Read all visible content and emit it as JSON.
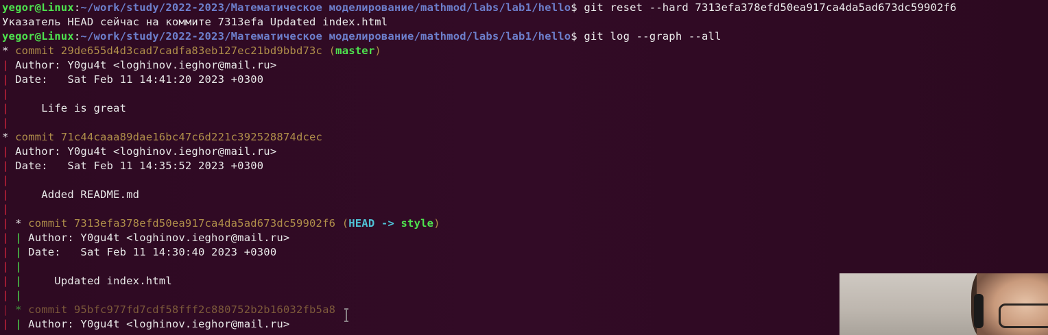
{
  "prompt1": {
    "user_host": "yegor@Linux",
    "sep": ":",
    "path": "~/work/study/2022-2023/Математическое моделирование/mathmod/labs/lab1/hello",
    "dollar": "$ ",
    "command": "git reset --hard 7313efa378efd50ea917ca4da5ad673dc59902f6"
  },
  "output1": "Указатель HEAD сейчас на коммите 7313efa Updated index.html",
  "prompt2": {
    "user_host": "yegor@Linux",
    "sep": ":",
    "path": "~/work/study/2022-2023/Математическое моделирование/mathmod/labs/lab1/hello",
    "dollar": "$ ",
    "command": "git log --graph --all"
  },
  "log": {
    "c1": {
      "star": "* ",
      "commit": "commit 29de655d4d3cad7cadfa83eb127ec21bd9bbd73c",
      "ref_open": " (",
      "ref1": "master",
      "ref_close": ")",
      "author": "Author: Y0gu4t <loghinov.ieghor@mail.ru>",
      "date": "Date:   Sat Feb 11 14:41:20 2023 +0300",
      "message": "    Life is great"
    },
    "c2": {
      "star": "* ",
      "commit": "commit 71c44caaa89dae16bc47c6d221c392528874dcec",
      "author": "Author: Y0gu4t <loghinov.ieghor@mail.ru>",
      "date": "Date:   Sat Feb 11 14:35:52 2023 +0300",
      "message": "    Added README.md"
    },
    "c3": {
      "star": "* ",
      "commit": "commit 7313efa378efd50ea917ca4da5ad673dc59902f6",
      "ref_open": " (",
      "ref_head": "HEAD",
      "ref_arrow": " -> ",
      "ref_style": "style",
      "ref_close": ")",
      "author": "Author: Y0gu4t <loghinov.ieghor@mail.ru>",
      "date": "Date:   Sat Feb 11 14:30:40 2023 +0300",
      "message": "    Updated index.html"
    },
    "c4": {
      "star": "* ",
      "commit": "commit 95bfc977fd7cdf58fff2c880752b2b16032fb5a8",
      "author": "Author: Y0gu4t <loghinov.ieghor@mail.ru>"
    }
  },
  "graph": {
    "bar": "| ",
    "bar2": "| | ",
    "bar2_empty": "| |",
    "space": "  "
  },
  "colors": {
    "background": "#300a24",
    "prompt_user": "#4ee34e",
    "prompt_path": "#6d7fcc",
    "commit_hash": "#b08f4a",
    "graph_red": "#d7263d",
    "graph_green": "#4ee34e",
    "head_ref": "#4fc3d6"
  }
}
